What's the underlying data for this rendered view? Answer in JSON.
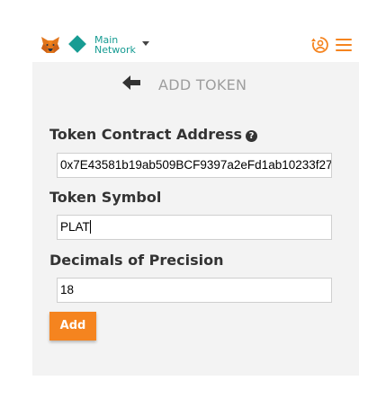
{
  "header": {
    "network_line1": "Main",
    "network_line2": "Network",
    "icons": [
      "metamask-fox-icon",
      "network-diamond-icon",
      "chevron-down-icon",
      "account-switch-icon",
      "hamburger-menu-icon"
    ],
    "brand_color": "#f5841f",
    "network_color": "#179c93"
  },
  "page": {
    "title": "ADD TOKEN"
  },
  "form": {
    "contract_label": "Token Contract Address",
    "contract_value": "0x7E43581b19ab509BCF9397a2eFd1ab10233f27",
    "symbol_label": "Token Symbol",
    "symbol_value": "PLAT",
    "decimals_label": "Decimals of Precision",
    "decimals_value": "18",
    "add_label": "Add"
  }
}
